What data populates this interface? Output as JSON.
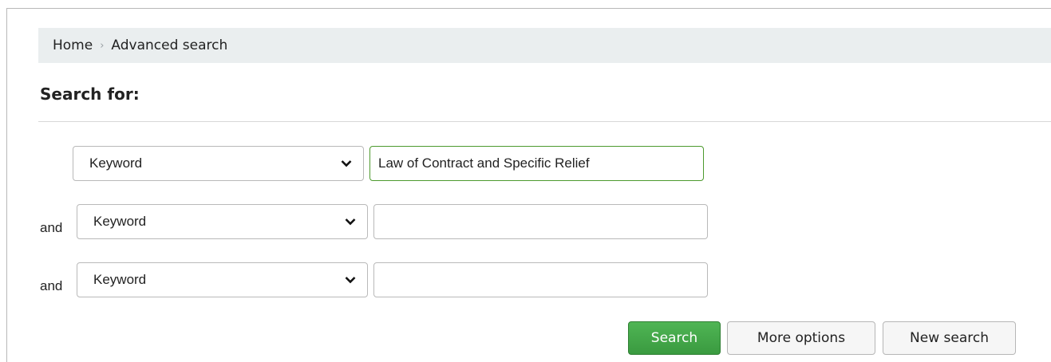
{
  "breadcrumb": {
    "home": "Home",
    "separator": "›",
    "current": "Advanced search"
  },
  "page_title": "Search for:",
  "search_rows": [
    {
      "operator": "",
      "index": "Keyword",
      "value": "Law of Contract and Specific Relief"
    },
    {
      "operator": "and",
      "index": "Keyword",
      "value": ""
    },
    {
      "operator": "and",
      "index": "Keyword",
      "value": ""
    }
  ],
  "buttons": {
    "search": "Search",
    "more_options": "More options",
    "new_search": "New search"
  },
  "colors": {
    "primary_button": "#3fa345",
    "focus_border": "#4d9a2e",
    "breadcrumb_bg": "#eaeeef"
  }
}
